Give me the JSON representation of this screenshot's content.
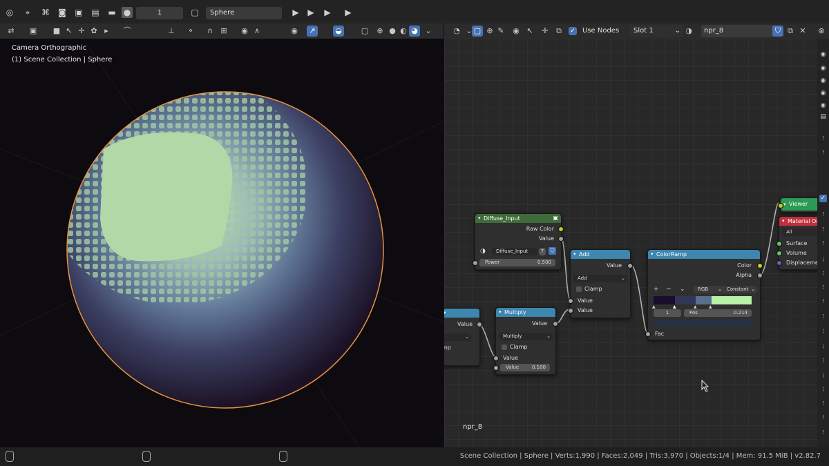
{
  "topbar": {
    "frame_value": "1",
    "object_name": "Sphere"
  },
  "nodeeditor_header": {
    "use_nodes_label": "Use Nodes",
    "slot_label": "Slot 1",
    "material_name": "npr_8"
  },
  "viewport": {
    "camera_label": "Camera Orthographic",
    "collection_label": "(1) Scene Collection | Sphere"
  },
  "nodes": {
    "diffuse_input": {
      "title": "Diffuse_Input",
      "out_raw_color": "Raw Color",
      "out_value": "Value",
      "group_name": "Diffuse_Input",
      "users": "7",
      "power_label": "Power",
      "power_value": "0.500"
    },
    "add": {
      "title": "Add",
      "out_value": "Value",
      "operation": "Add",
      "clamp": "Clamp",
      "in_value1": "Value",
      "in_value2": "Value"
    },
    "multiply": {
      "title": "Multiply",
      "out_value": "Value",
      "operation": "Multiply",
      "clamp": "Clamp",
      "in_value1": "Value",
      "in_value2_label": "Value",
      "in_value2": "0.100"
    },
    "partial": {
      "out_value": "Value",
      "clamp_fragment": "mp"
    },
    "colorramp": {
      "title": "ColorRamp",
      "out_color": "Color",
      "out_alpha": "Alpha",
      "plus": "+",
      "minus": "−",
      "mode": "RGB",
      "interpolation": "Constant",
      "stop_index": "1",
      "pos_label": "Pos",
      "pos_value": "0.214",
      "in_fac": "Fac"
    },
    "viewer": {
      "title": "Viewer"
    },
    "material_output": {
      "title": "Material Out",
      "target": "All",
      "in_surface": "Surface",
      "in_volume": "Volume",
      "in_displacement": "Displacement"
    }
  },
  "nodeeditor_material_label": "npr_8",
  "statusbar": {
    "text": "Scene Collection | Sphere | Verts:1,990 | Faces:2,049 | Tris:3,970 | Objects:1/4 | Mem: 91.5 MiB | v2.82.7"
  },
  "colors": {
    "accent": "#4772b3",
    "node_header_input": "#3f6b3a",
    "node_header_converter": "#3c86b0",
    "node_header_output": "#c02f3f",
    "viewer_header": "#2c9a54",
    "sphere_highlight": "#b3d8a8",
    "sphere_mid": "#6f8aa8",
    "sphere_outline": "#e8933a"
  },
  "icons": [
    "blender-icon",
    "cursor-icon",
    "camera-icon",
    "render-icon",
    "eye-icon",
    "shield-icon",
    "copy-icon",
    "close-icon",
    "play-icon"
  ]
}
